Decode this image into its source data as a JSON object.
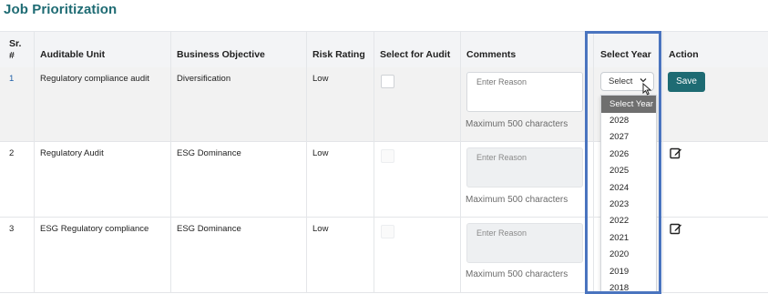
{
  "page": {
    "title": "Job Prioritization"
  },
  "table": {
    "headers": [
      "Sr. #",
      "Auditable Unit",
      "Business Objective",
      "Risk Rating",
      "Select for Audit",
      "Comments",
      "Select Year",
      "Action"
    ],
    "rows": [
      {
        "sr": "1",
        "unit": "Regulatory compliance audit",
        "objective": "Diversification",
        "risk": "Low",
        "comment_placeholder": "Enter Reason",
        "max_note": "Maximum 500 characters"
      },
      {
        "sr": "2",
        "unit": "Regulatory Audit",
        "objective": "ESG Dominance",
        "risk": "Low",
        "comment_placeholder": "Enter Reason",
        "max_note": "Maximum 500 characters"
      },
      {
        "sr": "3",
        "unit": "ESG Regulatory compliance",
        "objective": "ESG Dominance",
        "risk": "Low",
        "comment_placeholder": "Enter Reason",
        "max_note": "Maximum 500 characters"
      }
    ]
  },
  "year_select": {
    "current_value": "Select",
    "options": [
      "Select Year",
      "2028",
      "2027",
      "2026",
      "2025",
      "2024",
      "2023",
      "2022",
      "2021",
      "2020",
      "2019",
      "2018"
    ]
  },
  "actions": {
    "save_label": "Save"
  },
  "icons": {
    "select": "chevron-down-icon",
    "cursor": "cursor-arrow-icon",
    "edit": "edit-icon"
  },
  "colors": {
    "accent": "#1e6b73",
    "highlight": "#4a74bf",
    "placeholder_option_bg": "#6f6f6f"
  }
}
